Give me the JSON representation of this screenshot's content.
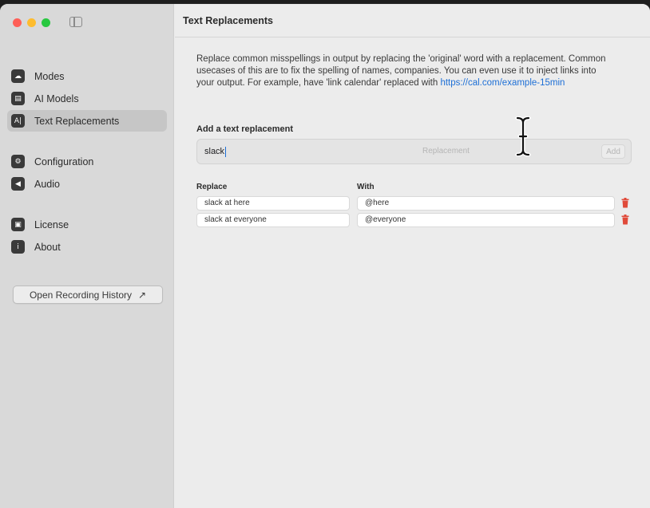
{
  "window": {
    "title": "Text Replacements"
  },
  "sidebar": {
    "items": [
      {
        "label": "Modes",
        "icon": "modes-icon",
        "glyph": "☁"
      },
      {
        "label": "AI Models",
        "icon": "ai-models-icon",
        "glyph": "▤"
      },
      {
        "label": "Text Replacements",
        "icon": "text-replacements-icon",
        "glyph": "A|",
        "active": true
      },
      {
        "label": "Configuration",
        "icon": "configuration-icon",
        "glyph": "⚙"
      },
      {
        "label": "Audio",
        "icon": "audio-icon",
        "glyph": "◀"
      },
      {
        "label": "License",
        "icon": "license-icon",
        "glyph": "▣"
      },
      {
        "label": "About",
        "icon": "about-icon",
        "glyph": "i"
      }
    ],
    "history_button": "Open Recording History",
    "history_arrow": "↗"
  },
  "main": {
    "description_text": "Replace common misspellings in output by replacing the 'original' word with a replacement. Common usecases of this are to fix the spelling of names, companies. You can even use it to inject links into your output. For example, have 'link calendar' replaced with ",
    "description_link": "https://cal.com/example-15min",
    "add_label": "Add a text replacement",
    "add_input_value": "slack",
    "replacement_placeholder": "Replacement",
    "add_button": "Add",
    "col_replace": "Replace",
    "col_with": "With",
    "rows": [
      {
        "replace": "slack at here",
        "with": "@here"
      },
      {
        "replace": "slack at everyone",
        "with": "@everyone"
      }
    ]
  },
  "colors": {
    "accent": "#1d6fd6",
    "delete": "#e04a3a",
    "sidebar_bg": "#d9d9d9",
    "window_bg": "#ececec"
  }
}
